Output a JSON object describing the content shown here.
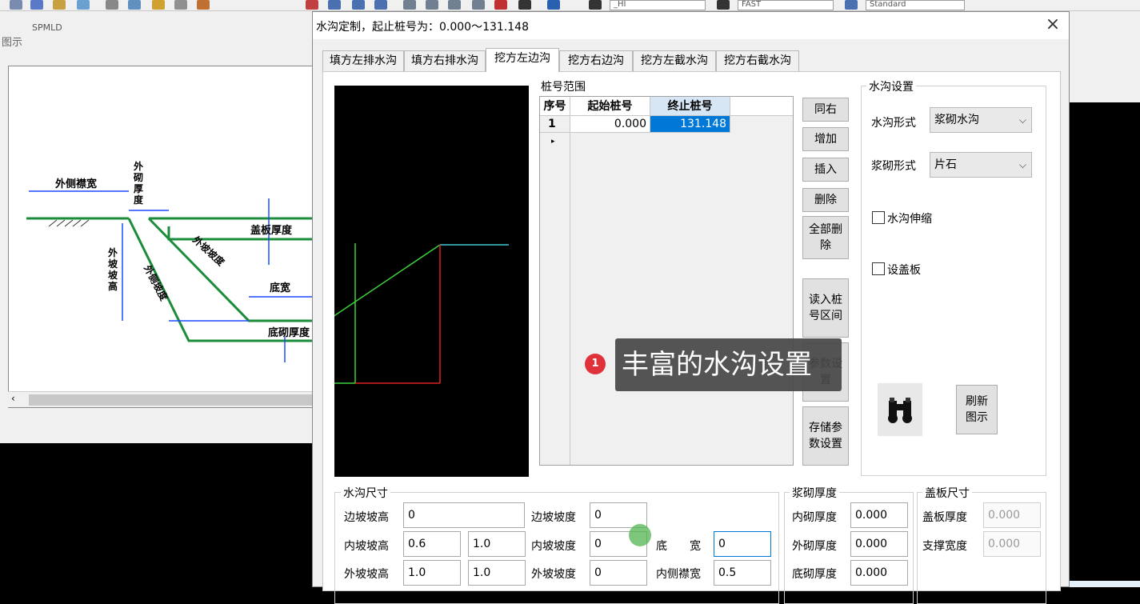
{
  "background": {
    "toolbar_combos": [
      "_HI",
      "FAST",
      "Standard"
    ],
    "panel_title": "图示",
    "tree_label": "SPMLD",
    "diagram_labels": {
      "outer_berm_width": "外侧襟宽",
      "outer_thickness": "外砌厚度",
      "cover_thickness": "盖板厚度",
      "outer_slope_height": "外坡坡高",
      "inner_slope_height": "外侧坡度",
      "outer_slope_ratio": "外坡坡度",
      "bottom_width": "底宽",
      "bottom_thickness": "底砌厚度"
    }
  },
  "dialog": {
    "title": "水沟定制，起止桩号为：0.000～131.148",
    "close_glyph": "×",
    "tabs": [
      "填方左排水沟",
      "填方右排水沟",
      "挖方左边沟",
      "挖方右边沟",
      "挖方左截水沟",
      "挖方右截水沟"
    ],
    "active_tab_index": 2,
    "station_group": {
      "label": "桩号范围",
      "columns": [
        "序号",
        "起始桩号",
        "终止桩号"
      ],
      "rows": [
        {
          "index": "1",
          "marker": "▸",
          "start": "0.000",
          "end": "131.148"
        }
      ]
    },
    "buttons": {
      "same_right": "同右",
      "add": "增加",
      "insert": "插入",
      "delete": "删除",
      "delete_all": "全部删除",
      "read_range": "读入桩号区间",
      "param_settings": "参数设置",
      "save_params": "存储参数设置",
      "refresh_preview": "刷新图示"
    },
    "ditch_settings": {
      "label": "水沟设置",
      "form_label": "水沟形式",
      "form_value": "浆砌水沟",
      "masonry_label": "浆砌形式",
      "masonry_value": "片石",
      "expand_label": "水沟伸缩",
      "expand_checked": false,
      "cover_label": "设盖板",
      "cover_checked": false
    },
    "dimensions": {
      "label": "水沟尺寸",
      "side_slope_height_label": "边坡坡高",
      "side_slope_height": "0",
      "side_slope_ratio_label": "边坡坡度",
      "side_slope_ratio": "0",
      "inner_slope_height_label": "内坡坡高",
      "inner_slope_height_a": "0.6",
      "inner_slope_height_b": "1.0",
      "inner_slope_ratio_label": "内坡坡度",
      "inner_slope_ratio": "0",
      "bottom_width_label": "底　　宽",
      "bottom_width": "0",
      "outer_slope_height_label": "外坡坡高",
      "outer_slope_height_a": "1.0",
      "outer_slope_height_b": "1.0",
      "outer_slope_ratio_label": "外坡坡度",
      "outer_slope_ratio": "0",
      "inner_berm_label": "内侧襟宽",
      "inner_berm": "0.5"
    },
    "masonry_thickness": {
      "label": "浆砌厚度",
      "inner_label": "内砌厚度",
      "inner": "0.000",
      "outer_label": "外砌厚度",
      "outer": "0.000",
      "bottom_label": "底砌厚度",
      "bottom": "0.000"
    },
    "cover_size": {
      "label": "盖板尺寸",
      "thickness_label": "盖板厚度",
      "thickness": "0.000",
      "support_label": "支撑宽度",
      "support": "0.000"
    }
  },
  "callout": {
    "number": "1",
    "text": "丰富的水沟设置"
  }
}
